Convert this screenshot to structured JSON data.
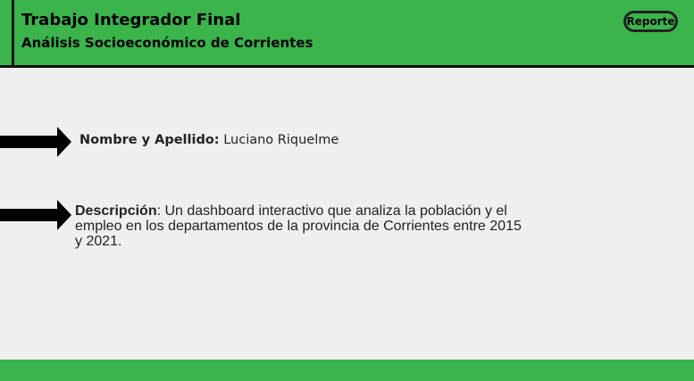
{
  "header": {
    "title": "Trabajo Integrador Final",
    "subtitle": "Análisis Socioeconómico de Corrientes",
    "report_button_label": "Reporte"
  },
  "main": {
    "name": {
      "label": "Nombre y Apellido:",
      "value": "Luciano Riquelme"
    },
    "description": {
      "label": "Descripción",
      "separator": ": ",
      "text": "Un dashboard interactivo que analiza la población y el empleo en los departamentos de la provincia de Corrientes entre 2015 y 2021."
    }
  },
  "icons": {
    "arrow": "arrow-right-icon"
  },
  "colors": {
    "header_background": "#3ab44b",
    "footer_background": "#3ab44b",
    "page_background": "#efefef",
    "text": "#222222",
    "arrow": "#000000"
  }
}
